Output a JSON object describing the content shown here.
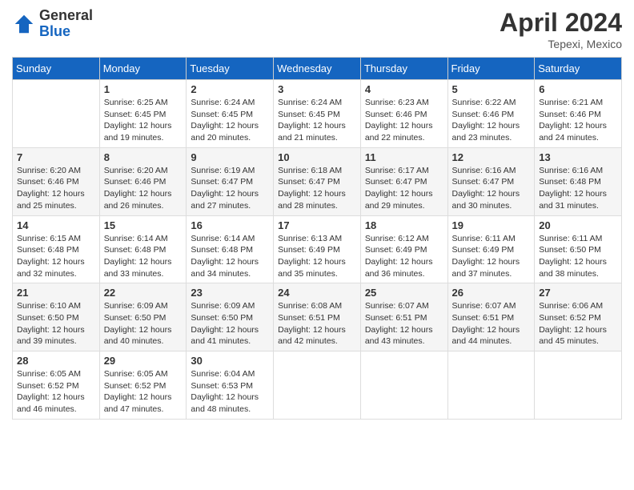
{
  "header": {
    "logo_line1": "General",
    "logo_line2": "Blue",
    "month_title": "April 2024",
    "location": "Tepexi, Mexico"
  },
  "columns": [
    "Sunday",
    "Monday",
    "Tuesday",
    "Wednesday",
    "Thursday",
    "Friday",
    "Saturday"
  ],
  "weeks": [
    [
      {
        "day": "",
        "info": ""
      },
      {
        "day": "1",
        "info": "Sunrise: 6:25 AM\nSunset: 6:45 PM\nDaylight: 12 hours and 19 minutes."
      },
      {
        "day": "2",
        "info": "Sunrise: 6:24 AM\nSunset: 6:45 PM\nDaylight: 12 hours and 20 minutes."
      },
      {
        "day": "3",
        "info": "Sunrise: 6:24 AM\nSunset: 6:45 PM\nDaylight: 12 hours and 21 minutes."
      },
      {
        "day": "4",
        "info": "Sunrise: 6:23 AM\nSunset: 6:46 PM\nDaylight: 12 hours and 22 minutes."
      },
      {
        "day": "5",
        "info": "Sunrise: 6:22 AM\nSunset: 6:46 PM\nDaylight: 12 hours and 23 minutes."
      },
      {
        "day": "6",
        "info": "Sunrise: 6:21 AM\nSunset: 6:46 PM\nDaylight: 12 hours and 24 minutes."
      }
    ],
    [
      {
        "day": "7",
        "info": "Sunrise: 6:20 AM\nSunset: 6:46 PM\nDaylight: 12 hours and 25 minutes."
      },
      {
        "day": "8",
        "info": "Sunrise: 6:20 AM\nSunset: 6:46 PM\nDaylight: 12 hours and 26 minutes."
      },
      {
        "day": "9",
        "info": "Sunrise: 6:19 AM\nSunset: 6:47 PM\nDaylight: 12 hours and 27 minutes."
      },
      {
        "day": "10",
        "info": "Sunrise: 6:18 AM\nSunset: 6:47 PM\nDaylight: 12 hours and 28 minutes."
      },
      {
        "day": "11",
        "info": "Sunrise: 6:17 AM\nSunset: 6:47 PM\nDaylight: 12 hours and 29 minutes."
      },
      {
        "day": "12",
        "info": "Sunrise: 6:16 AM\nSunset: 6:47 PM\nDaylight: 12 hours and 30 minutes."
      },
      {
        "day": "13",
        "info": "Sunrise: 6:16 AM\nSunset: 6:48 PM\nDaylight: 12 hours and 31 minutes."
      }
    ],
    [
      {
        "day": "14",
        "info": "Sunrise: 6:15 AM\nSunset: 6:48 PM\nDaylight: 12 hours and 32 minutes."
      },
      {
        "day": "15",
        "info": "Sunrise: 6:14 AM\nSunset: 6:48 PM\nDaylight: 12 hours and 33 minutes."
      },
      {
        "day": "16",
        "info": "Sunrise: 6:14 AM\nSunset: 6:48 PM\nDaylight: 12 hours and 34 minutes."
      },
      {
        "day": "17",
        "info": "Sunrise: 6:13 AM\nSunset: 6:49 PM\nDaylight: 12 hours and 35 minutes."
      },
      {
        "day": "18",
        "info": "Sunrise: 6:12 AM\nSunset: 6:49 PM\nDaylight: 12 hours and 36 minutes."
      },
      {
        "day": "19",
        "info": "Sunrise: 6:11 AM\nSunset: 6:49 PM\nDaylight: 12 hours and 37 minutes."
      },
      {
        "day": "20",
        "info": "Sunrise: 6:11 AM\nSunset: 6:50 PM\nDaylight: 12 hours and 38 minutes."
      }
    ],
    [
      {
        "day": "21",
        "info": "Sunrise: 6:10 AM\nSunset: 6:50 PM\nDaylight: 12 hours and 39 minutes."
      },
      {
        "day": "22",
        "info": "Sunrise: 6:09 AM\nSunset: 6:50 PM\nDaylight: 12 hours and 40 minutes."
      },
      {
        "day": "23",
        "info": "Sunrise: 6:09 AM\nSunset: 6:50 PM\nDaylight: 12 hours and 41 minutes."
      },
      {
        "day": "24",
        "info": "Sunrise: 6:08 AM\nSunset: 6:51 PM\nDaylight: 12 hours and 42 minutes."
      },
      {
        "day": "25",
        "info": "Sunrise: 6:07 AM\nSunset: 6:51 PM\nDaylight: 12 hours and 43 minutes."
      },
      {
        "day": "26",
        "info": "Sunrise: 6:07 AM\nSunset: 6:51 PM\nDaylight: 12 hours and 44 minutes."
      },
      {
        "day": "27",
        "info": "Sunrise: 6:06 AM\nSunset: 6:52 PM\nDaylight: 12 hours and 45 minutes."
      }
    ],
    [
      {
        "day": "28",
        "info": "Sunrise: 6:05 AM\nSunset: 6:52 PM\nDaylight: 12 hours and 46 minutes."
      },
      {
        "day": "29",
        "info": "Sunrise: 6:05 AM\nSunset: 6:52 PM\nDaylight: 12 hours and 47 minutes."
      },
      {
        "day": "30",
        "info": "Sunrise: 6:04 AM\nSunset: 6:53 PM\nDaylight: 12 hours and 48 minutes."
      },
      {
        "day": "",
        "info": ""
      },
      {
        "day": "",
        "info": ""
      },
      {
        "day": "",
        "info": ""
      },
      {
        "day": "",
        "info": ""
      }
    ]
  ]
}
